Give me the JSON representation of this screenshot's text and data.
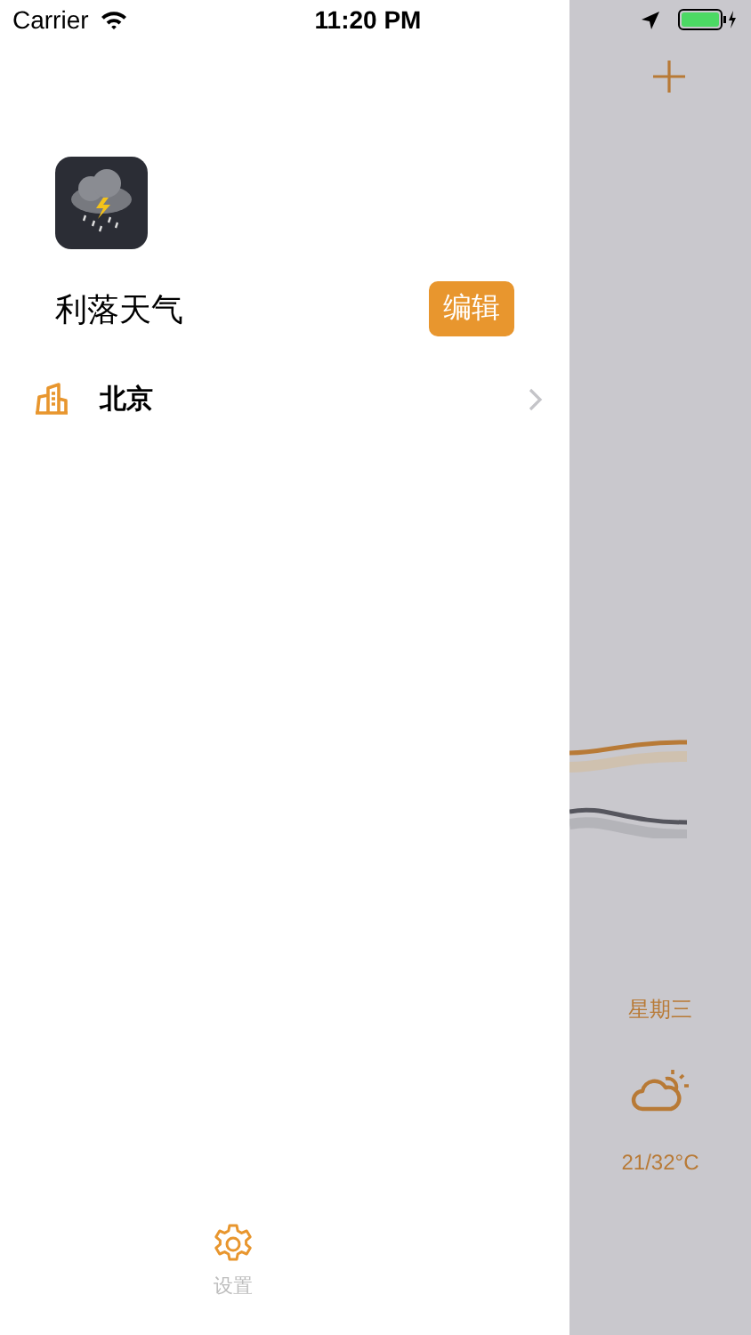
{
  "status_bar": {
    "carrier": "Carrier",
    "time": "11:20 PM"
  },
  "drawer": {
    "app_name": "利落天气",
    "edit_button": "编辑",
    "cities": [
      {
        "name": "北京"
      }
    ],
    "settings_label": "设置"
  },
  "forecast": {
    "day": "星期三",
    "temperature": "21/32°C"
  }
}
